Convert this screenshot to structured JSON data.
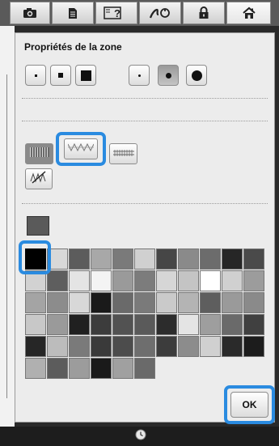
{
  "toolbar": {
    "buttons": [
      {
        "name": "camera-icon"
      },
      {
        "name": "document-icon"
      },
      {
        "name": "help-icon"
      },
      {
        "name": "stitch-icon"
      },
      {
        "name": "lock-icon"
      },
      {
        "name": "home-icon"
      }
    ]
  },
  "panel": {
    "title": "Propriétés de la zone",
    "ok_label": "OK"
  },
  "stitch_sizes": {
    "selected_index": 4,
    "items": [
      "small-square",
      "medium-square",
      "large-square",
      "small-dot",
      "medium-dot",
      "large-dot"
    ]
  },
  "fill_types": {
    "selected_index": 1,
    "items": [
      "pattern-fill-1",
      "pattern-fill-2",
      "pattern-fill-3",
      "no-fill"
    ]
  },
  "palette": {
    "selected_index": 0,
    "current_color": "#5a5a5a",
    "colors": [
      "#000000",
      "#d8d8d8",
      "#5c5c5c",
      "#a8a8a8",
      "#7a7a7a",
      "#d0d0d0",
      "#464646",
      "#8a8a8a",
      "#6c6c6c",
      "#262626",
      "#4a4a4a",
      "#d2d2d2",
      "#5e5e5e",
      "#e4e4e4",
      "#f4f4f4",
      "#9a9a9a",
      "#7c7c7c",
      "#d6d6d6",
      "#c4c4c4",
      "#ffffff",
      "#d0d0d0",
      "#9c9c9c",
      "#a4a4a4",
      "#8c8c8c",
      "#d8d8d8",
      "#1a1a1a",
      "#6a6a6a",
      "#7a7a7a",
      "#cacaca",
      "#b4b4b4",
      "#5e5e5e",
      "#9a9a9a",
      "#8a8a8a",
      "#c8c8c8",
      "#9a9a9a",
      "#202020",
      "#3c3c3c",
      "#525252",
      "#5a5a5a",
      "#2c2c2c",
      "#e4e4e4",
      "#9e9e9e",
      "#6a6a6a",
      "#404040",
      "#262626",
      "#bcbcbc",
      "#7a7a7a",
      "#3a3a3a",
      "#4c4c4c",
      "#6e6e6e",
      "#3c3c3c",
      "#8c8c8c",
      "#d0d0d0",
      "#2a2a2a",
      "#1c1c1c",
      "#b0b0b0",
      "#5c5c5c",
      "#9c9c9c",
      "#1a1a1a",
      "#a0a0a0",
      "#6a6a6a"
    ]
  }
}
